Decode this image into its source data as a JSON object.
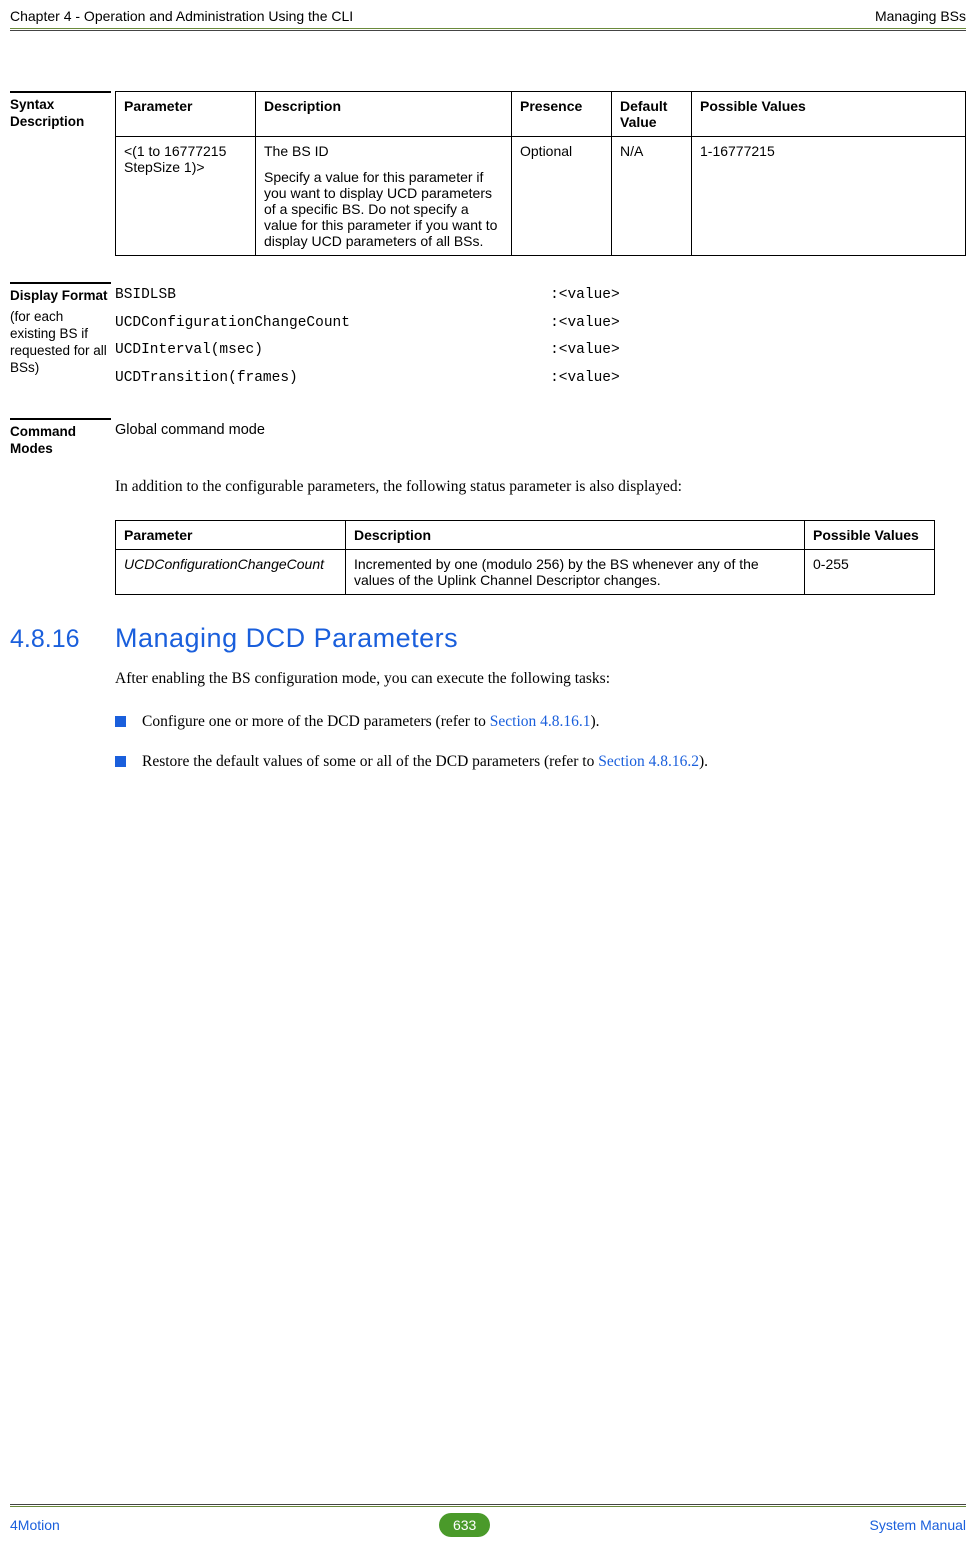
{
  "header": {
    "left": "Chapter 4 - Operation and Administration Using the CLI",
    "right": "Managing BSs"
  },
  "syntax": {
    "label": "Syntax Description",
    "headers": {
      "param": "Parameter",
      "desc": "Description",
      "presence": "Presence",
      "default": "Default Value",
      "possible": "Possible Values"
    },
    "row": {
      "param": "<(1 to 16777215 StepSize 1)>",
      "desc1": "The BS ID",
      "desc2": "Specify a value for this parameter if you want to display UCD parameters of a specific BS. Do not specify a value for this parameter if you want to display UCD parameters of all BSs.",
      "presence": "Optional",
      "default": "N/A",
      "possible": "1-16777215"
    }
  },
  "display": {
    "label_bold": "Display Format",
    "label_reg": "(for each existing BS if requested for all BSs)",
    "lines": [
      "BSIDLSB                                           :<value>",
      "UCDConfigurationChangeCount                       :<value>",
      "UCDInterval(msec)                                 :<value>",
      "UCDTransition(frames)                             :<value>"
    ]
  },
  "cmdmodes": {
    "label": "Command Modes",
    "text": "Global command mode"
  },
  "body1": "In addition to the configurable parameters, the following status parameter is also displayed:",
  "status": {
    "headers": {
      "param": "Parameter",
      "desc": "Description",
      "possible": "Possible Values"
    },
    "row": {
      "param": "UCDConfigurationChangeCount",
      "desc": "Incremented by one (modulo 256) by the BS whenever any of the values of the Uplink Channel Descriptor changes.",
      "possible": "0-255"
    }
  },
  "section": {
    "num": "4.8.16",
    "title": "Managing DCD Parameters",
    "intro": "After enabling the BS configuration mode, you can execute the following tasks:",
    "b1_a": "Configure one or more of the DCD parameters (refer to ",
    "b1_link": "Section 4.8.16.1",
    "b1_b": ").",
    "b2_a": "Restore the default values of some or all of the DCD parameters (refer to ",
    "b2_link": "Section 4.8.16.2",
    "b2_b": ")."
  },
  "footer": {
    "left": "4Motion",
    "page": "633",
    "right": "System Manual"
  }
}
